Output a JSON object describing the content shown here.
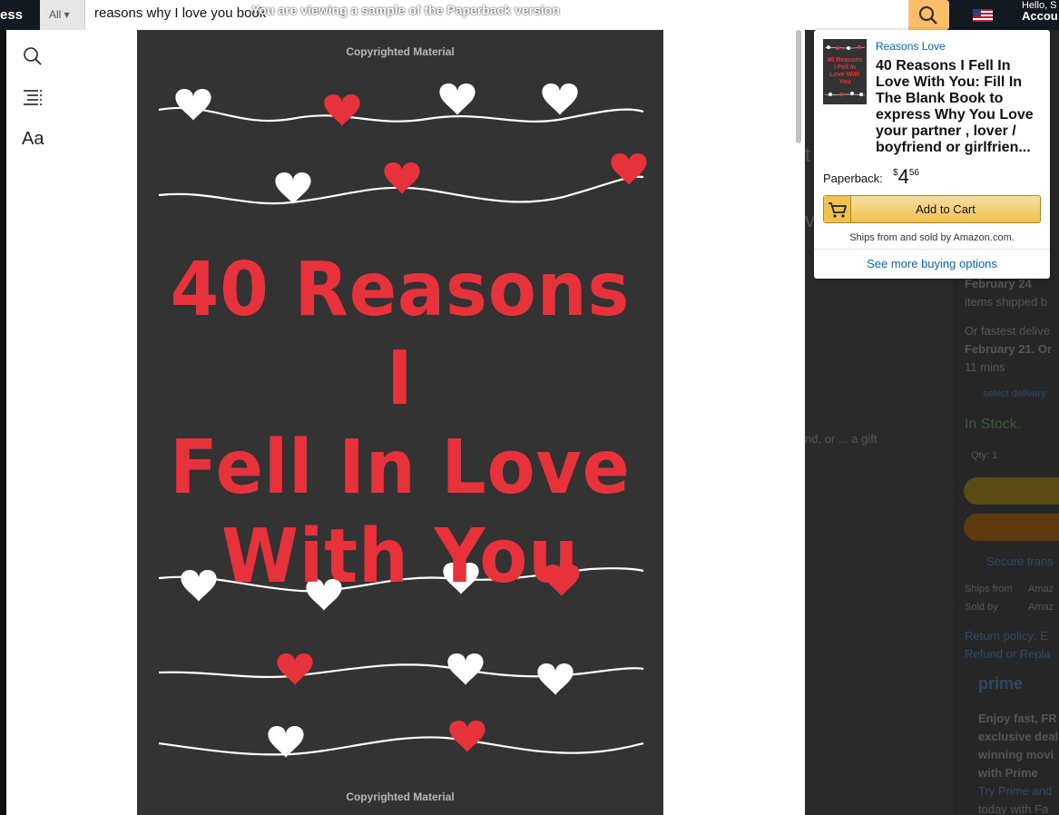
{
  "banner": {
    "prefix": "You are viewing a sample of the",
    "format": "Paperback",
    "suffix": "version"
  },
  "background": {
    "logo_fragment": "ess",
    "search_category": "All",
    "search_query": "reasons why I love you book",
    "account_greeting": "Hello, S",
    "account_label": "Accou",
    "text_fragments": [
      "February 24",
      "items shipped b",
      "Or fastest delive",
      "February 21. Or",
      "11 mins",
      "select delivery",
      "In Stock.",
      "Qty: 1",
      "Secure trans",
      "Ships from",
      "Amaz",
      "Sold by",
      "Amaz",
      "Return policy: E",
      "Refund or Repla",
      "prime",
      "Enjoy fast, FR",
      "exclusive deal",
      "winning movi",
      "with Prime",
      "Try Prime and",
      "today with Fa",
      "nd, or ... a gift",
      "v",
      "t"
    ]
  },
  "reader": {
    "tools": {
      "font_label": "Aa"
    },
    "page": {
      "copyright_top": "Copyrighted Material",
      "copyright_bottom": "Copyrighted Material",
      "cover_title_lines": [
        "40 Reasons I",
        "Fell In Love",
        "With You"
      ]
    }
  },
  "popover": {
    "author": "Reasons Love",
    "title": "40 Reasons I Fell In Love With You: Fill In The Blank Book to express Why You Love your partner , lover / boyfriend or girlfrien...",
    "thumb_text": "40 Reasons I Fell In Love With You",
    "format_label": "Paperback:",
    "price_symbol": "$",
    "price_dollars": "4",
    "price_cents": "56",
    "add_to_cart": "Add to Cart",
    "ships_text": "Ships from and sold by Amazon.com.",
    "more_options": "See more buying options"
  },
  "colors": {
    "cover_bg": "#333333",
    "cover_title": "#e8323b",
    "heart_red": "#e8323b",
    "heart_white": "#ffffff",
    "link": "#0066c0",
    "button_yellow": "#f0c14b"
  }
}
